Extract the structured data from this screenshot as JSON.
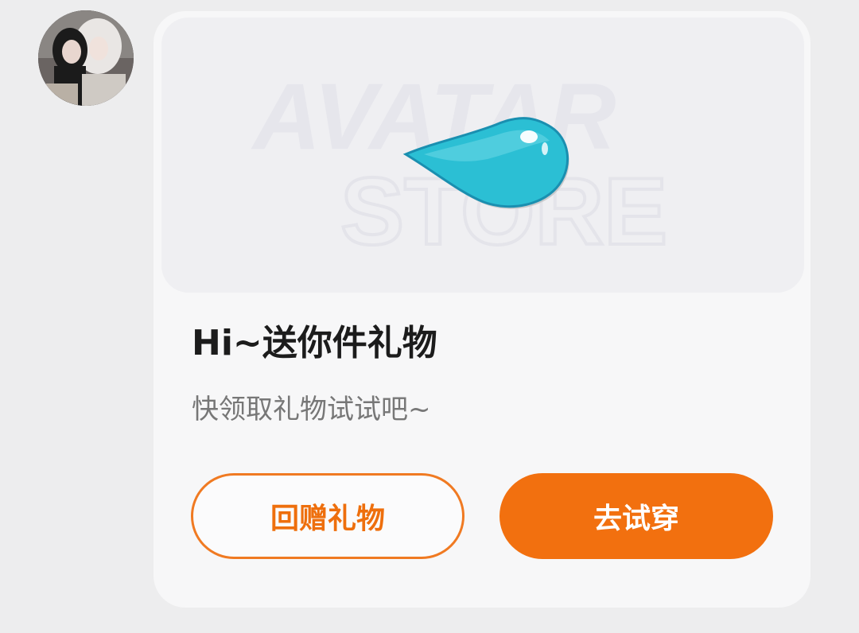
{
  "message": {
    "sender_avatar_alt": "user avatar photo",
    "card": {
      "banner": {
        "watermark_line1": "AVATAR",
        "watermark_line2": "STORE",
        "gift_item_icon": "teal-droplet-icon"
      },
      "title": "Hi~送你件礼物",
      "subtitle": "快领取礼物试试吧~",
      "buttons": {
        "return_gift_label": "回赠礼物",
        "try_on_label": "去试穿"
      }
    }
  },
  "colors": {
    "accent": "#f2700f",
    "card_bg": "#f7f7f8",
    "page_bg": "#ededee",
    "droplet": "#2bbfd4"
  }
}
